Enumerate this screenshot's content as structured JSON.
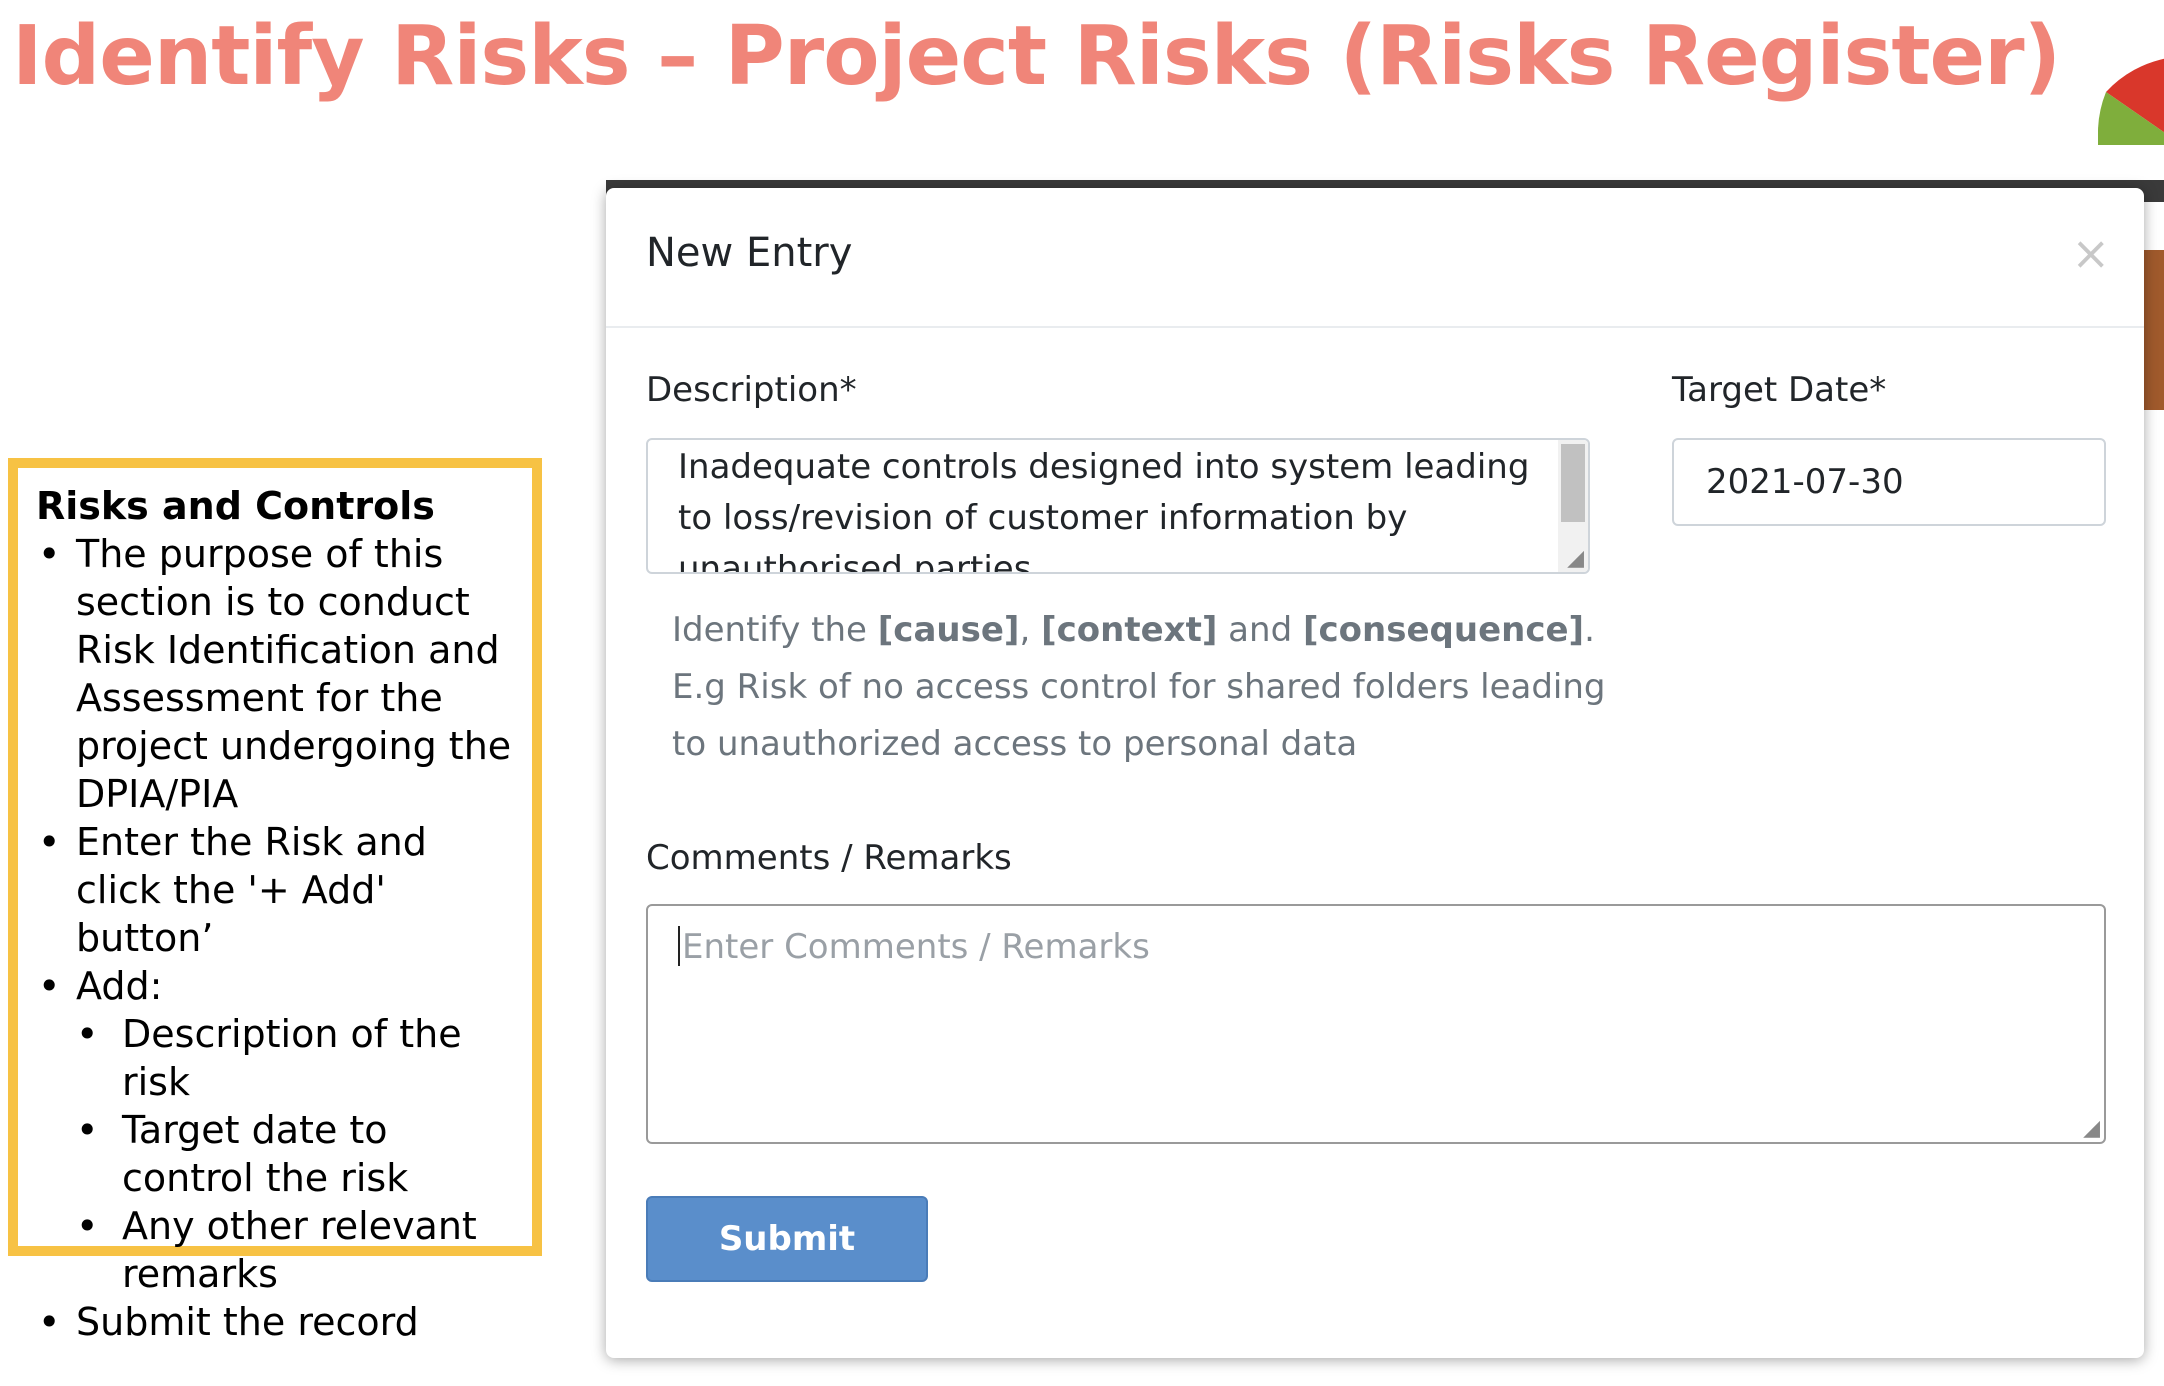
{
  "slide": {
    "title": "Identify Risks – Project Risks (Risks Register)"
  },
  "note": {
    "heading": "Risks and Controls",
    "items": [
      "The purpose of this section is to conduct Risk Identification and Assessment for the project undergoing the DPIA/PIA",
      "Enter the Risk and click the '+ Add' button’",
      "Add:",
      "Submit the record"
    ],
    "subitems": [
      "Description of the risk",
      "Target date to control the risk",
      "Any other relevant remarks"
    ],
    "bullet": "•"
  },
  "modal": {
    "title": "New Entry",
    "close_symbol": "×",
    "description_label": "Description*",
    "description_value": "Inadequate controls designed into system leading to loss/revision of customer information by unauthorised parties",
    "target_date_label": "Target Date*",
    "target_date_value": "2021-07-30",
    "help": {
      "prefix": "Identify the ",
      "cause": "[cause]",
      "sep1": ", ",
      "context": "[context]",
      "sep2": " and ",
      "consequence": "[consequence]",
      "suffix": ".",
      "example": "E.g Risk of no access control for shared folders leading to unauthorized access to personal data"
    },
    "comments_label": "Comments / Remarks",
    "comments_placeholder": "Enter Comments / Remarks",
    "comments_value": "",
    "submit_label": "Submit"
  },
  "colors": {
    "title": "#f08579",
    "note_border": "#f7c244",
    "submit": "#5a8ecb"
  }
}
